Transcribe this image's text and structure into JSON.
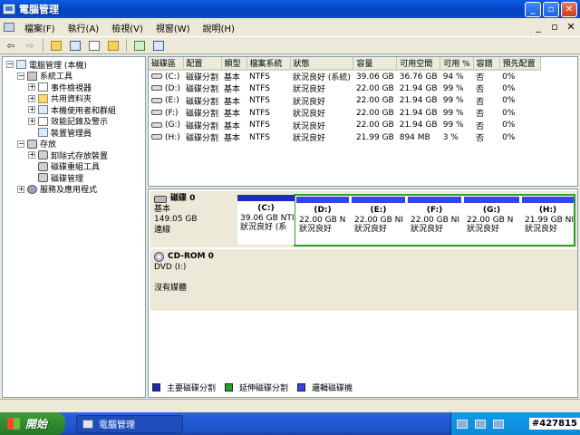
{
  "window": {
    "title": "電腦管理"
  },
  "menu": [
    "檔案(F)",
    "執行(A)",
    "檢視(V)",
    "視窗(W)",
    "說明(H)"
  ],
  "tree": [
    {
      "label": "電腦管理 (本機)",
      "level": 0,
      "exp": "−",
      "icon": "computer-icon"
    },
    {
      "label": "系統工具",
      "level": 1,
      "exp": "−",
      "icon": "tools-icon"
    },
    {
      "label": "事件檢視器",
      "level": 2,
      "exp": "+",
      "icon": "event-viewer-icon"
    },
    {
      "label": "共用資料夾",
      "level": 2,
      "exp": "+",
      "icon": "shared-folder-icon"
    },
    {
      "label": "本機使用者和群組",
      "level": 2,
      "exp": "+",
      "icon": "users-icon"
    },
    {
      "label": "效能記錄及警示",
      "level": 2,
      "exp": "+",
      "icon": "performance-log-icon"
    },
    {
      "label": "裝置管理員",
      "level": 2,
      "exp": "",
      "icon": "device-manager-icon"
    },
    {
      "label": "存放",
      "level": 1,
      "exp": "−",
      "icon": "storage-icon"
    },
    {
      "label": "卸除式存放裝置",
      "level": 2,
      "exp": "+",
      "icon": "removable-storage-icon"
    },
    {
      "label": "磁碟重組工具",
      "level": 2,
      "exp": "",
      "icon": "defrag-icon"
    },
    {
      "label": "磁碟管理",
      "level": 2,
      "exp": "",
      "icon": "disk-management-icon"
    },
    {
      "label": "服務及應用程式",
      "level": 1,
      "exp": "+",
      "icon": "services-icon"
    }
  ],
  "volume_table": {
    "headers": [
      "磁碟區",
      "配置",
      "類型",
      "檔案系統",
      "狀態",
      "容量",
      "可用空間",
      "可用 %",
      "容錯",
      "預先配置"
    ],
    "rows": [
      [
        "(C:)",
        "磁碟分割",
        "基本",
        "NTFS",
        "狀況良好 (系統)",
        "39.06 GB",
        "36.76 GB",
        "94 %",
        "否",
        "0%"
      ],
      [
        "(D:)",
        "磁碟分割",
        "基本",
        "NTFS",
        "狀況良好",
        "22.00 GB",
        "21.94 GB",
        "99 %",
        "否",
        "0%"
      ],
      [
        "(E:)",
        "磁碟分割",
        "基本",
        "NTFS",
        "狀況良好",
        "22.00 GB",
        "21.94 GB",
        "99 %",
        "否",
        "0%"
      ],
      [
        "(F:)",
        "磁碟分割",
        "基本",
        "NTFS",
        "狀況良好",
        "22.00 GB",
        "21.94 GB",
        "99 %",
        "否",
        "0%"
      ],
      [
        "(G:)",
        "磁碟分割",
        "基本",
        "NTFS",
        "狀況良好",
        "22.00 GB",
        "21.94 GB",
        "99 %",
        "否",
        "0%"
      ],
      [
        "(H:)",
        "磁碟分割",
        "基本",
        "NTFS",
        "狀況良好",
        "21.99 GB",
        "894 MB",
        "3 %",
        "否",
        "0%"
      ]
    ]
  },
  "disk0": {
    "name": "磁碟 0",
    "type": "基本",
    "size": "149.05 GB",
    "status": "連線",
    "partitions": [
      {
        "letter": "(C:)",
        "size": "39.06 GB NTI",
        "status": "狀況良好 (系",
        "kind": "primary"
      },
      {
        "letter": "(D:)",
        "size": "22.00 GB N",
        "status": "狀況良好",
        "kind": "logical"
      },
      {
        "letter": "(E:)",
        "size": "22.00 GB NI",
        "status": "狀況良好",
        "kind": "logical"
      },
      {
        "letter": "(F:)",
        "size": "22.00 GB NI",
        "status": "狀況良好",
        "kind": "logical"
      },
      {
        "letter": "(G:)",
        "size": "22.00 GB N",
        "status": "狀況良好",
        "kind": "logical"
      },
      {
        "letter": "(H:)",
        "size": "21.99 GB NI",
        "status": "狀況良好",
        "kind": "logical"
      }
    ]
  },
  "cdrom0": {
    "name": "CD-ROM 0",
    "drive": "DVD (I:)",
    "status": "沒有媒體"
  },
  "legend": [
    "主要磁碟分割",
    "延伸磁碟分割",
    "邏輯磁碟機"
  ],
  "colors": {
    "primary": "#1e2bb8",
    "extended": "#2ba12b",
    "logical": "#3546e8"
  },
  "taskbar": {
    "start": "開始",
    "task": "電腦管理",
    "clock": "#427815"
  }
}
